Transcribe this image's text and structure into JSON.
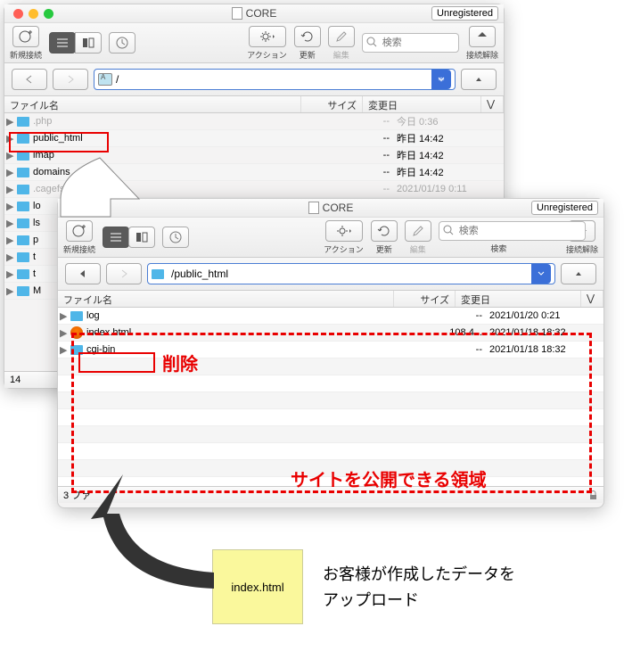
{
  "window1": {
    "title": "CORE",
    "badge": "Unregistered",
    "toolbar": {
      "new_conn": "新規接続",
      "action": "アクション",
      "refresh": "更新",
      "edit": "編集",
      "search_ph": "検索",
      "disconnect": "接続解除"
    },
    "path": "/",
    "headers": {
      "name": "ファイル名",
      "size": "サイズ",
      "date": "変更日"
    },
    "rows": [
      {
        "name": ".php",
        "size": "--",
        "date": "今日 0:36",
        "dim": true
      },
      {
        "name": "public_html",
        "size": "--",
        "date": "昨日 14:42"
      },
      {
        "name": "imap",
        "size": "--",
        "date": "昨日 14:42"
      },
      {
        "name": "domains",
        "size": "--",
        "date": "昨日 14:42"
      },
      {
        "name": ".cagefs",
        "size": "--",
        "date": "2021/01/19 0:11",
        "dim": true
      },
      {
        "name": "lo"
      },
      {
        "name": "ls"
      },
      {
        "name": "p"
      },
      {
        "name": "t"
      },
      {
        "name": "t"
      },
      {
        "name": "M"
      }
    ],
    "status": "14"
  },
  "window2": {
    "title": "CORE",
    "badge": "Unregistered",
    "toolbar": {
      "new_conn": "新規接続",
      "action": "アクション",
      "refresh": "更新",
      "edit": "編集",
      "search_ph": "検索",
      "search_lbl": "検索",
      "disconnect": "接続解除"
    },
    "path": "/public_html",
    "headers": {
      "name": "ファイル名",
      "size": "サイズ",
      "date": "変更日"
    },
    "rows": [
      {
        "name": "log",
        "size": "--",
        "date": "2021/01/20 0:21",
        "folder": true
      },
      {
        "name": "index.html",
        "size": "108.4...",
        "date": "2021/01/18 18:32",
        "folder": false
      },
      {
        "name": "cgi-bin",
        "size": "--",
        "date": "2021/01/18 18:32",
        "folder": true
      }
    ],
    "status": "3 ファ"
  },
  "annotations": {
    "delete": "削除",
    "public_area": "サイトを公開できる領域",
    "note_file": "index.html",
    "note_text1": "お客様が作成したデータを",
    "note_text2": "アップロード"
  }
}
